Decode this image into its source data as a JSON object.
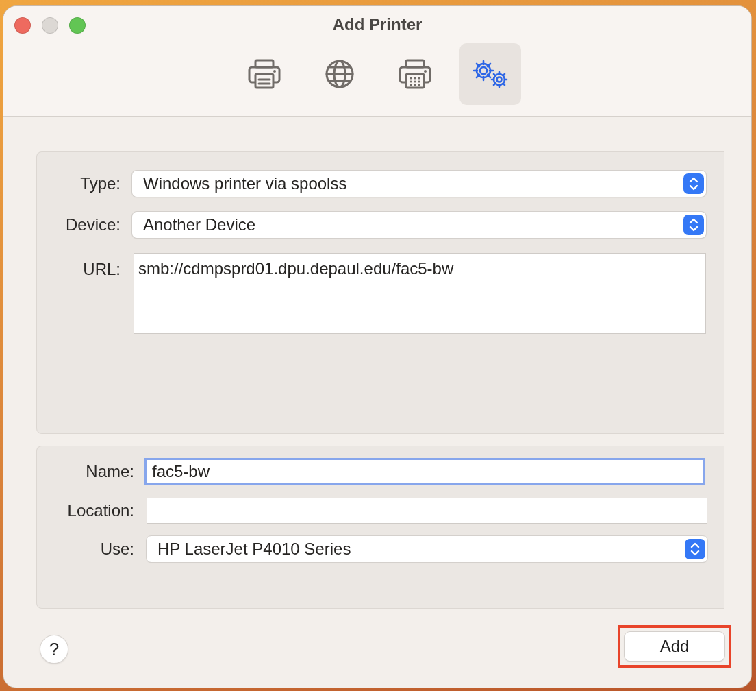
{
  "window": {
    "title": "Add Printer"
  },
  "toolbar": [
    {
      "kind": "printer",
      "selected": false
    },
    {
      "kind": "globe",
      "selected": false
    },
    {
      "kind": "fax",
      "selected": false
    },
    {
      "kind": "gears",
      "selected": true
    }
  ],
  "connection": {
    "type": {
      "label": "Type:",
      "value": "Windows printer via spoolss"
    },
    "device": {
      "label": "Device:",
      "value": "Another Device"
    },
    "url": {
      "label": "URL:",
      "value": "smb://cdmpsprd01.dpu.depaul.edu/fac5-bw"
    }
  },
  "details": {
    "name": {
      "label": "Name:",
      "value": "fac5-bw",
      "focused": true
    },
    "location": {
      "label": "Location:"
    },
    "use": {
      "label": "Use:",
      "value": "HP LaserJet P4010 Series"
    }
  },
  "help_button": {
    "label": "?"
  },
  "add_button": {
    "label": "Add",
    "highlighted": true
  }
}
